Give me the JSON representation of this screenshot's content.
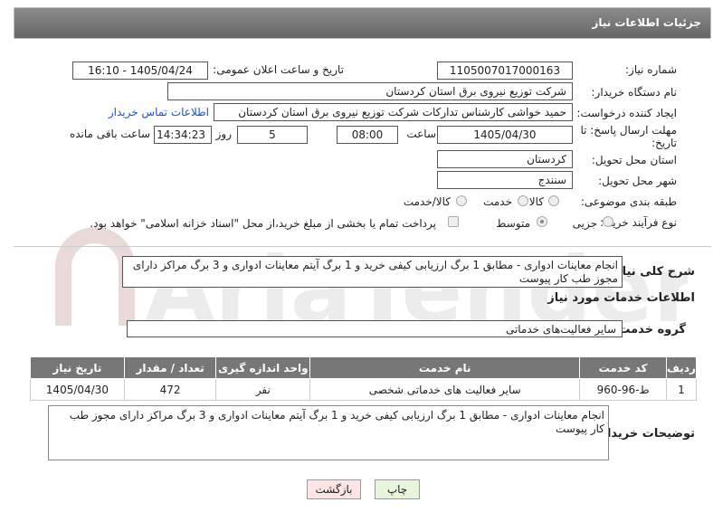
{
  "header": {
    "title": "جزئیات اطلاعات نیاز"
  },
  "fields": {
    "need_number_label": "شماره نیاز:",
    "need_number": "1105007017000163",
    "announce_label": "تاریخ و ساعت اعلان عمومی:",
    "announce_value": "1405/04/24 - 16:10",
    "buyer_org_label": "نام دستگاه خریدار:",
    "buyer_org": "شرکت توزیع نیروی برق استان کردستان",
    "requester_label": "ایجاد کننده درخواست:",
    "requester": "حمید خواشی کارشناس تدارکات شرکت توزیع نیروی برق استان کردستان",
    "contact_link": "اطلاعات تماس خریدار",
    "deadline_label_1": "مهلت ارسال پاسخ: تا",
    "deadline_label_2": "تاریخ:",
    "deadline_date": "1405/04/30",
    "time_label": "ساعت",
    "deadline_time": "08:00",
    "days_value": "5",
    "days_label": "روز و",
    "remaining_time": "14:34:23",
    "remaining_label": "ساعت باقی مانده",
    "province_label": "استان محل تحویل:",
    "province": "کردستان",
    "city_label": "شهر محل تحویل:",
    "city": "سنندج",
    "category_label": "طبقه بندی موضوعی:",
    "category_options": [
      "کالا",
      "خدمت",
      "کالا/خدمت"
    ],
    "process_label": "نوع فرآیند خرید :",
    "process_options": [
      "جزیی",
      "متوسط"
    ],
    "payment_note": "پرداخت تمام یا بخشی از مبلغ خرید،از محل \"اسناد خزانه اسلامی\" خواهد بود."
  },
  "summary": {
    "label": "شرح کلی نیاز:",
    "text": "انجام معاینات ادواری - مطابق 1 برگ ارزیابی کیفی خرید و 1 برگ آیتم معاینات ادواری و 3 برگ مراکز دارای مجوز طب کار پیوست"
  },
  "services": {
    "section_title": "اطلاعات خدمات مورد نیاز",
    "group_label": "گروه خدمت:",
    "group_value": "سایر فعالیت‌های خدماتی",
    "columns": [
      "ردیف",
      "کد خدمت",
      "نام خدمت",
      "واحد اندازه گیری",
      "تعداد / مقدار",
      "تاریخ نیاز"
    ],
    "rows": [
      [
        "1",
        "ط-96-960",
        "سایر فعالیت های خدماتی شخصی",
        "نفر",
        "472",
        "1405/04/30"
      ]
    ]
  },
  "buyer_notes": {
    "label": "توضیحات خریدار:",
    "text": "انجام معاینات ادواری - مطابق 1 برگ ارزیابی کیفی خرید و 1 برگ آیتم معاینات ادواری و 3 برگ مراکز دارای مجوز طب کار پیوست"
  },
  "buttons": {
    "print": "چاپ",
    "back": "بازگشت"
  },
  "colors": {
    "header_bg": "#777777",
    "back_bg": "#fde5e5",
    "print_bg": "#e6f5dc",
    "link": "#1a56c4"
  }
}
